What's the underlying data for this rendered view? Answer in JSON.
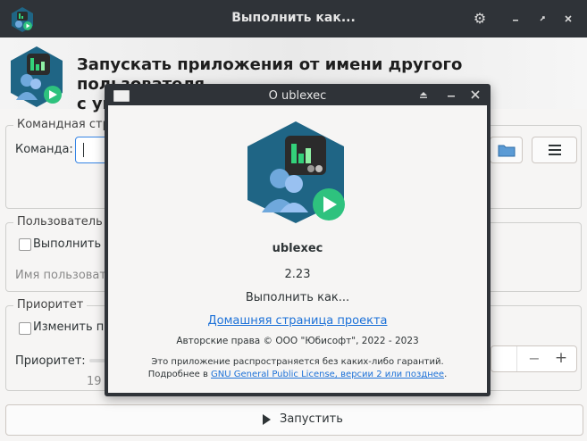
{
  "window": {
    "title": "Выполнить как...",
    "header_title_line1": "Запускать приложения от имени другого пользователя",
    "header_title_line2": "с указанным приоритетом"
  },
  "command_group": {
    "legend": "Командная стро",
    "command_label": "Команда:",
    "command_value": ""
  },
  "user_group": {
    "legend": "Пользователь",
    "run_as_checkbox_label": "Выполнить о",
    "username_label": "Имя пользовате"
  },
  "priority_group": {
    "legend": "Приоритет",
    "change_checkbox_label": "Изменить пр",
    "priority_label": "Приоритет:",
    "scale_value": "19",
    "minus_label": "−",
    "plus_label": "+"
  },
  "run_button": {
    "label": "Запустить"
  },
  "about_dialog": {
    "title": "О ublexec",
    "app_name": "ublexec",
    "version": "2.23",
    "description": "Выполнить как...",
    "homepage_link": "Домашняя страница проекта",
    "copyright": "Авторские права © ООО \"Юбисофт\", 2022 - 2023",
    "license_line1": "Это приложение распространяется без каких-либо гарантий.",
    "license_line2_prefix": "Подробнее в ",
    "license_link": "GNU General Public License, версии 2 или позднее",
    "license_line2_suffix": "."
  },
  "colors": {
    "titlebar": "#2f3338",
    "accent": "#3584e4",
    "link": "#1c71d8",
    "logo_hex": "#1f6585",
    "logo_play": "#2ec27e"
  }
}
